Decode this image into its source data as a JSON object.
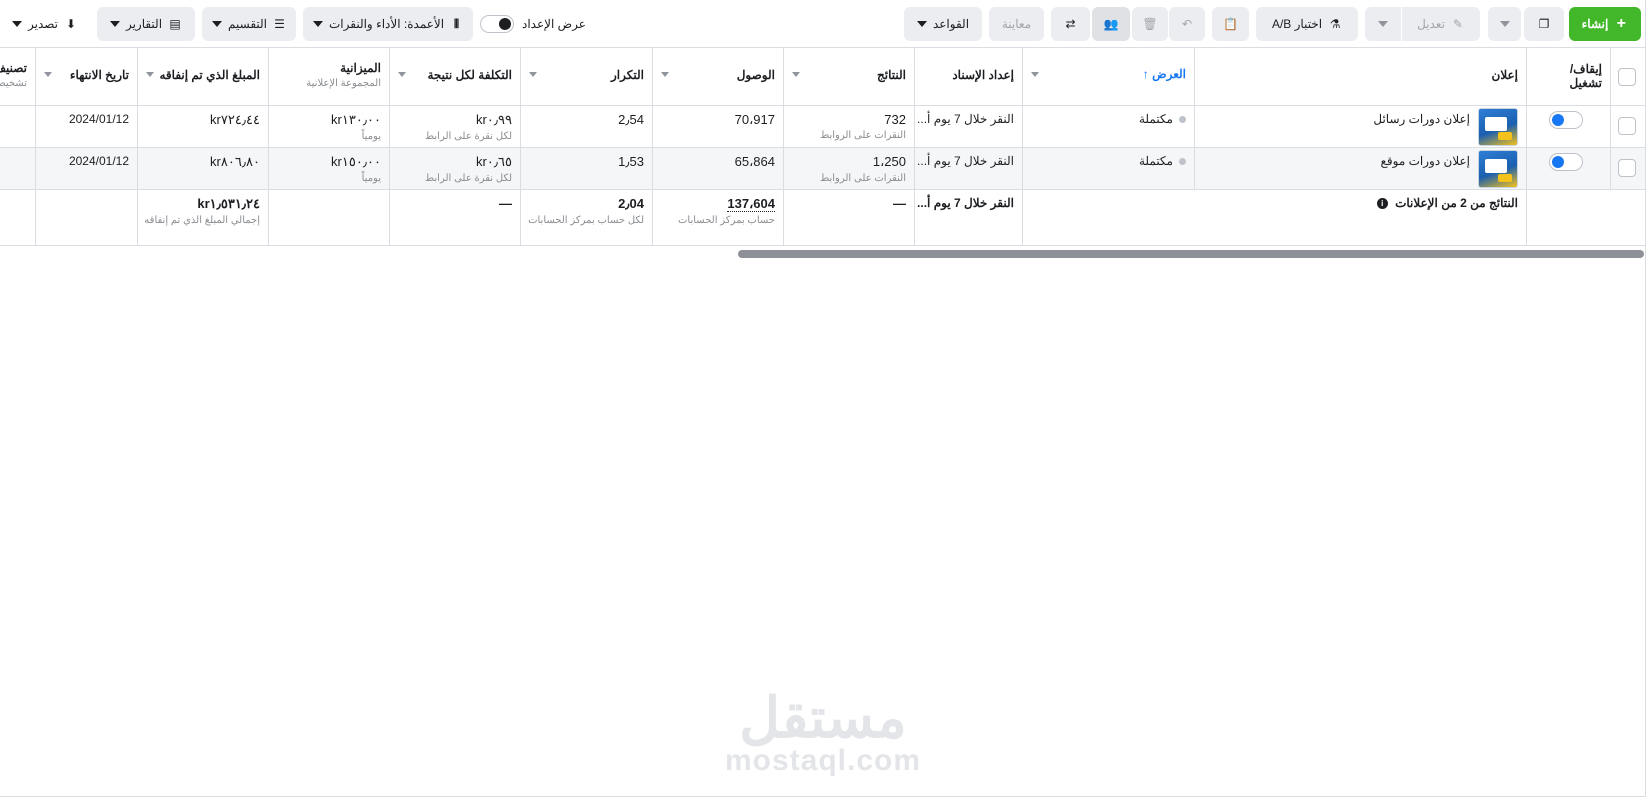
{
  "toolbar": {
    "create": "إنشاء",
    "edit": "تعديل",
    "ab_test": "اختبار A/B",
    "preview": "معاينة",
    "rules": "القواعد",
    "setup_toggle_label": "عرض الإعداد",
    "columns": "الأعمدة: الأداء والنقرات",
    "breakdown": "التقسيم",
    "reports": "التقارير",
    "export": "تصدير"
  },
  "table": {
    "headers": {
      "toggle": "إيقاف/\nتشغيل",
      "ad": "إعلان",
      "delivery": "العرض",
      "attribution": "إعداد الإسناد",
      "results": "النتائج",
      "reach": "الوصول",
      "frequency": "التكرار",
      "cost_per_result": "التكلفة لكل نتيجة",
      "budget": "الميزانية",
      "budget_sub": "المجموعة الإعلانية",
      "amount_spent": "المبلغ الذي تم إنفاقه",
      "end_date": "تاريخ الانتهاء",
      "ranking": "تصنيف",
      "ranking_sub": "تشخيص"
    },
    "rows": [
      {
        "ad_name": "إعلان دورات رسائل",
        "delivery": "مكتملة",
        "attribution": "النقر خلال 7 يوم أ...",
        "results": "732",
        "results_sub": "النقرات على الروابط",
        "reach": "70،917",
        "frequency": "2٫54",
        "cost_per_result": "kr٠٫٩٩",
        "cost_sub": "لكل نقرة على الرابط",
        "budget": "kr١٣٠٫٠٠",
        "budget_sub": "يومياً",
        "amount_spent": "kr٧٢٤٫٤٤",
        "end_date": "2024/01/12"
      },
      {
        "ad_name": "إعلان دورات موقع",
        "delivery": "مكتملة",
        "attribution": "النقر خلال 7 يوم أ...",
        "results": "1،250",
        "results_sub": "النقرات على الروابط",
        "reach": "65،864",
        "frequency": "1٫53",
        "cost_per_result": "kr٠٫٦٥",
        "cost_sub": "لكل نقرة على الرابط",
        "budget": "kr١٥٠٫٠٠",
        "budget_sub": "يومياً",
        "amount_spent": "kr٨٠٦٫٨٠",
        "end_date": "2024/01/12"
      }
    ],
    "summary": {
      "label": "النتائج من 2 من الإعلانات",
      "attribution": "النقر خلال 7 يوم أ...",
      "results": "—",
      "reach": "137،604",
      "reach_sub": "حساب بمركز الحسابات",
      "frequency": "2٫04",
      "frequency_sub": "لكل حساب بمركز الحسابات",
      "cost_per_result": "—",
      "amount_spent": "kr١٫٥٣١٫٢٤",
      "amount_spent_sub": "إجمالي المبلغ الذي تم إنفاقه"
    }
  },
  "watermark": {
    "arabic": "مستقل",
    "latin": "mostaql.com"
  },
  "colors": {
    "create_green": "#42b72a",
    "toggle_blue": "#1877f2",
    "sort_blue": "#1877f2"
  }
}
